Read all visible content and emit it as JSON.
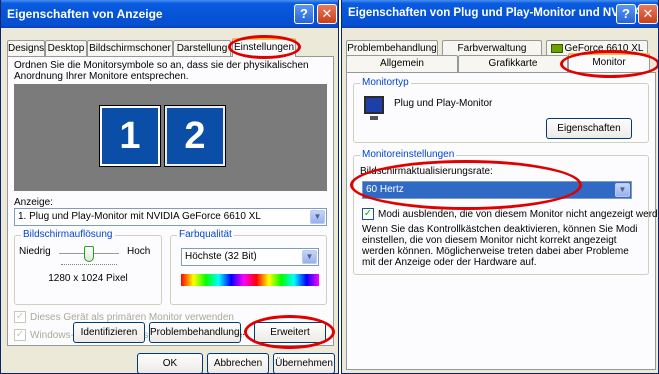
{
  "window1": {
    "title": "Eigenschaften von Anzeige",
    "help_btn": "?",
    "close_btn": "✕",
    "tabs": [
      "Designs",
      "Desktop",
      "Bildschirmschoner",
      "Darstellung",
      "Einstellungen"
    ],
    "instructions": "Ordnen Sie die Monitorsymbole so an, dass sie der physikalischen Anordnung Ihrer Monitore entsprechen.",
    "monitors": [
      "1",
      "2"
    ],
    "display_label": "Anzeige:",
    "display_value": "1. Plug und Play-Monitor mit NVIDIA GeForce 6610 XL",
    "resolution_group": "Bildschirmauflösung",
    "res_low": "Niedrig",
    "res_high": "Hoch",
    "res_value": "1280 x 1024 Pixel",
    "res_fraction": 0.5,
    "color_group": "Farbqualität",
    "color_value": "Höchste (32 Bit)",
    "check_primary": "Dieses Gerät als primären Monitor verwenden",
    "check_extend": "Windows-Desktop auf diesem Monitor erweitern",
    "btn_identify": "Identifizieren",
    "btn_troubleshoot": "Problembehandlung...",
    "btn_advanced": "Erweitert",
    "btn_ok": "OK",
    "btn_cancel": "Abbrechen",
    "btn_apply": "Übernehmen"
  },
  "window2": {
    "title": "Eigenschaften von Plug und Play-Monitor und NVIDIA ...",
    "help_btn": "?",
    "close_btn": "✕",
    "tabs_row1": [
      "Problembehandlung",
      "Farbverwaltung",
      "GeForce 6610 XL"
    ],
    "tabs_row2": [
      "Allgemein",
      "Grafikkarte",
      "Monitor"
    ],
    "monitortype_group": "Monitortyp",
    "monitor_name": "Plug und Play-Monitor",
    "btn_properties": "Eigenschaften",
    "settings_group": "Monitoreinstellungen",
    "refresh_label": "Bildschirmaktualisierungsrate:",
    "refresh_value": "60 Hertz",
    "hide_modes": "Modi ausblenden, die von diesem Monitor nicht angezeigt werden",
    "warning": "Wenn Sie das Kontrollkästchen deaktivieren, können Sie Modi einstellen, die von diesem Monitor nicht korrekt angezeigt werden können. Möglicherweise treten dabei aber Probleme mit der Anzeige oder der Hardware auf."
  },
  "colors": {
    "accent": "#e00000",
    "monitor_blue": "#0a4ea8",
    "selection": "#316ac5",
    "title_blue": "#0654d8"
  }
}
